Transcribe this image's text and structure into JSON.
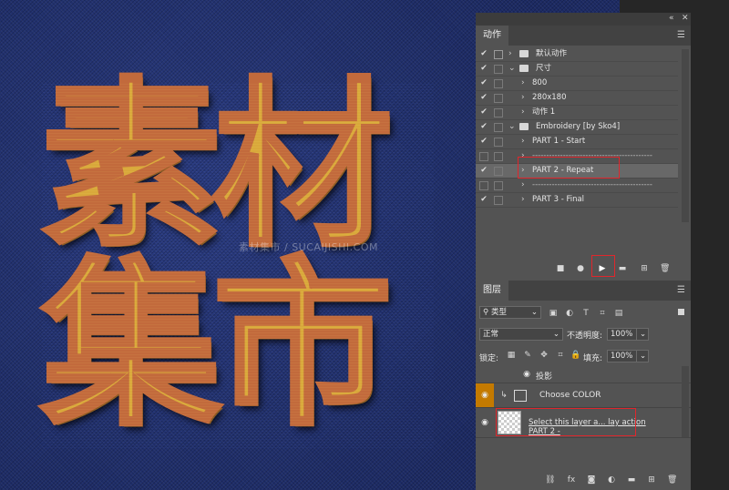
{
  "canvas": {
    "artwork_line1": "素材",
    "artwork_line2": "集市",
    "watermark": "素材集市 / SUCAIJISHI.COM"
  },
  "actions_panel": {
    "tab": "动作",
    "items": [
      {
        "label": "默认动作",
        "checked": true,
        "type": "set",
        "expanded": false
      },
      {
        "label": "尺寸",
        "checked": true,
        "type": "set",
        "expanded": true
      },
      {
        "label": "800",
        "checked": true,
        "type": "action"
      },
      {
        "label": "280x180",
        "checked": true,
        "type": "action"
      },
      {
        "label": "动作 1",
        "checked": true,
        "type": "action"
      },
      {
        "label": "Embroidery [by Sko4]",
        "checked": true,
        "type": "set",
        "expanded": true
      },
      {
        "label": "PART 1 - Start",
        "checked": true,
        "type": "action"
      },
      {
        "label": "-------------------------------------------",
        "checked": false,
        "type": "separator"
      },
      {
        "label": "PART 2 - Repeat",
        "checked": true,
        "type": "action",
        "selected": true
      },
      {
        "label": "-------------------------------------------",
        "checked": false,
        "type": "separator"
      },
      {
        "label": "PART 3 - Final",
        "checked": true,
        "type": "action"
      }
    ],
    "footer_icons": [
      "stop-icon",
      "record-icon",
      "play-icon",
      "folder-icon",
      "new-action-icon",
      "trash-icon"
    ]
  },
  "layers_panel": {
    "tab": "图层",
    "filter_label": "类型",
    "blend_mode": "正常",
    "opacity_label": "不透明度:",
    "opacity_value": "100%",
    "lock_label": "锁定:",
    "fill_label": "填充:",
    "fill_value": "100%",
    "effect_label": "投影",
    "layers": [
      {
        "name": "Choose COLOR",
        "visible": true
      },
      {
        "name": "Select this layer a... lay  action PART 2 -",
        "visible": true
      }
    ],
    "footer_icons": [
      "link-icon",
      "fx-icon",
      "mask-icon",
      "adjustment-icon",
      "group-icon",
      "new-layer-icon",
      "trash-icon"
    ]
  },
  "colors": {
    "denim": "#1f2e6b",
    "embroidery_fill": "#d9a83b",
    "embroidery_stitch": "#c26a3c",
    "panel_bg": "#535353",
    "highlight_red": "#e0262c",
    "layer_eye_bg": "#c47a00"
  }
}
